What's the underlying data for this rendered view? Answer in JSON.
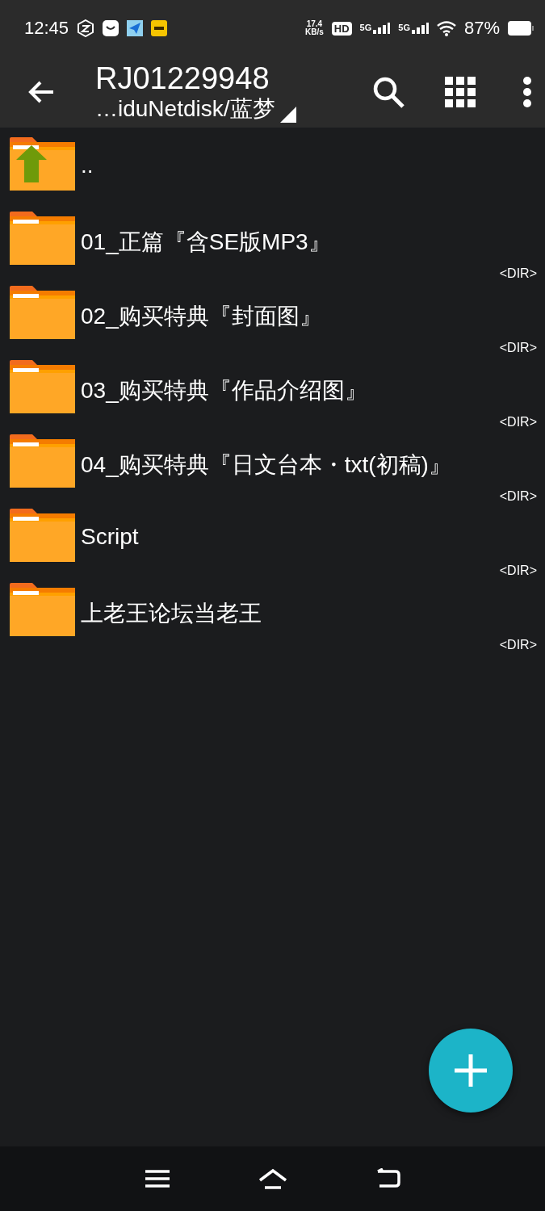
{
  "status_bar": {
    "time": "12:45",
    "net_speed": "17.4",
    "net_unit": "KB/s",
    "hd": "HD",
    "sim_1": "5G",
    "sim_2": "5G",
    "battery": "87%"
  },
  "toolbar": {
    "title": "RJ01229948",
    "path": "…iduNetdisk/蓝梦"
  },
  "files": [
    {
      "kind": "parent",
      "name": ".."
    },
    {
      "kind": "folder",
      "name": "01_正篇『含SE版MP3』",
      "info": "<DIR>"
    },
    {
      "kind": "folder",
      "name": "02_购买特典『封面图』",
      "info": "<DIR>"
    },
    {
      "kind": "folder",
      "name": "03_购买特典『作品介绍图』",
      "info": "<DIR>"
    },
    {
      "kind": "folder",
      "name": "04_购买特典『日文台本・txt(初稿)』",
      "info": "<DIR>"
    },
    {
      "kind": "folder",
      "name": "Script",
      "info": "<DIR>"
    },
    {
      "kind": "folder",
      "name": "上老王论坛当老王",
      "info": "<DIR>"
    }
  ]
}
